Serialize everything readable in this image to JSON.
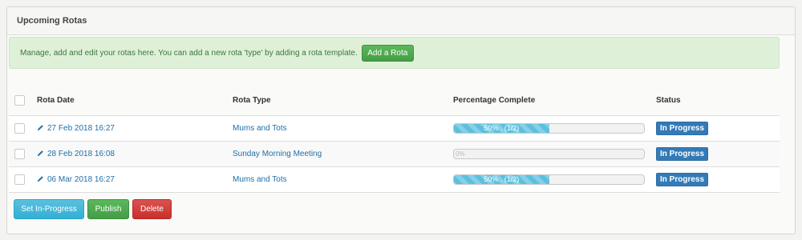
{
  "panel": {
    "title": "Upcoming Rotas"
  },
  "alert": {
    "text": "Manage, add and edit your rotas here. You can add a new rota 'type' by adding a rota template.",
    "add_button": "Add a Rota"
  },
  "table": {
    "headers": {
      "date": "Rota Date",
      "type": "Rota Type",
      "percentage": "Percentage Complete",
      "status": "Status"
    },
    "rows": [
      {
        "date": "27 Feb 2018 16:27",
        "type": "Mums and Tots",
        "progress_label": "50% . (1/2)",
        "progress_fraction": 0.5,
        "status": "In Progress"
      },
      {
        "date": "28 Feb 2018 16:08",
        "type": "Sunday Morning Meeting",
        "progress_label": "0%",
        "progress_fraction": 0.0,
        "status": "In Progress"
      },
      {
        "date": "06 Mar 2018 16:27",
        "type": "Mums and Tots",
        "progress_label": "50% . (1/2)",
        "progress_fraction": 0.5,
        "status": "In Progress"
      }
    ]
  },
  "actions": {
    "set_in_progress": "Set In-Progress",
    "publish": "Publish",
    "delete": "Delete"
  },
  "colors": {
    "link": "#1f6fa8",
    "progress": "#5bc0de",
    "status_badge": "#337ab7",
    "alert_bg": "#dff0d8"
  }
}
